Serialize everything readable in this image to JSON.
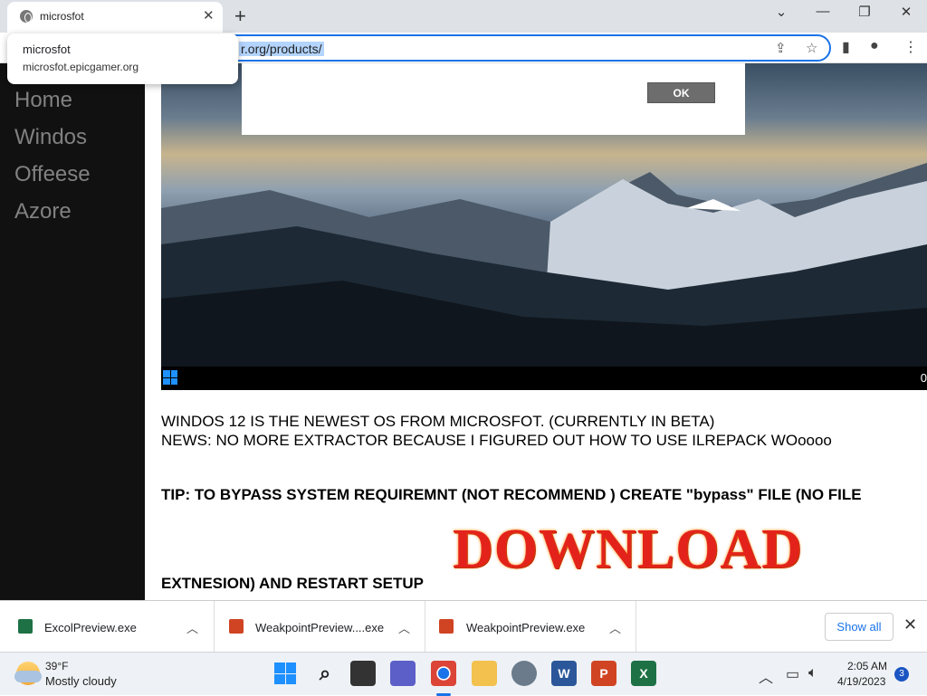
{
  "browser": {
    "tab_title": "microsfot",
    "new_tab": "+",
    "url_visible": "r.org/products/",
    "tooltip_title": "microsfot",
    "tooltip_url": "microsfot.epicgamer.org"
  },
  "window_controls": {
    "tabs": "⌄",
    "minimize": "—",
    "restore": "❐",
    "close": "✕"
  },
  "sidebar": {
    "items": [
      {
        "label": "Home"
      },
      {
        "label": "Windos"
      },
      {
        "label": "Offeese"
      },
      {
        "label": "Azore"
      }
    ]
  },
  "dialog": {
    "ok_label": "OK"
  },
  "hero": {
    "clock_partial": "0"
  },
  "content": {
    "line1": "WINDOS 12 IS THE NEWEST OS FROM MICROSFOT. (CURRENTLY IN BETA)",
    "line2": "NEWS: NO MORE EXTRACTOR BECAUSE I FIGURED OUT HOW TO USE ILREPACK WOoooo",
    "tip1": "TIP: TO BYPASS SYSTEM REQUIREMNT (NOT RECOMMEND ) CREATE \"bypass\" FILE (NO FILE",
    "tip2": "EXTNESION) AND RESTART SETUP",
    "download_label": "DOWNLOAD"
  },
  "downloads": {
    "items": [
      {
        "name": "ExcolPreview.exe",
        "color": "#1e7145"
      },
      {
        "name": "WeakpointPreview....exe",
        "color": "#d04423"
      },
      {
        "name": "WeakpointPreview.exe",
        "color": "#d04423"
      }
    ],
    "show_all": "Show all",
    "close": "✕"
  },
  "taskbar": {
    "weather_temp": "39°F",
    "weather_desc": "Mostly cloudy",
    "time": "2:05 AM",
    "date": "4/19/2023",
    "notifications": "3"
  }
}
